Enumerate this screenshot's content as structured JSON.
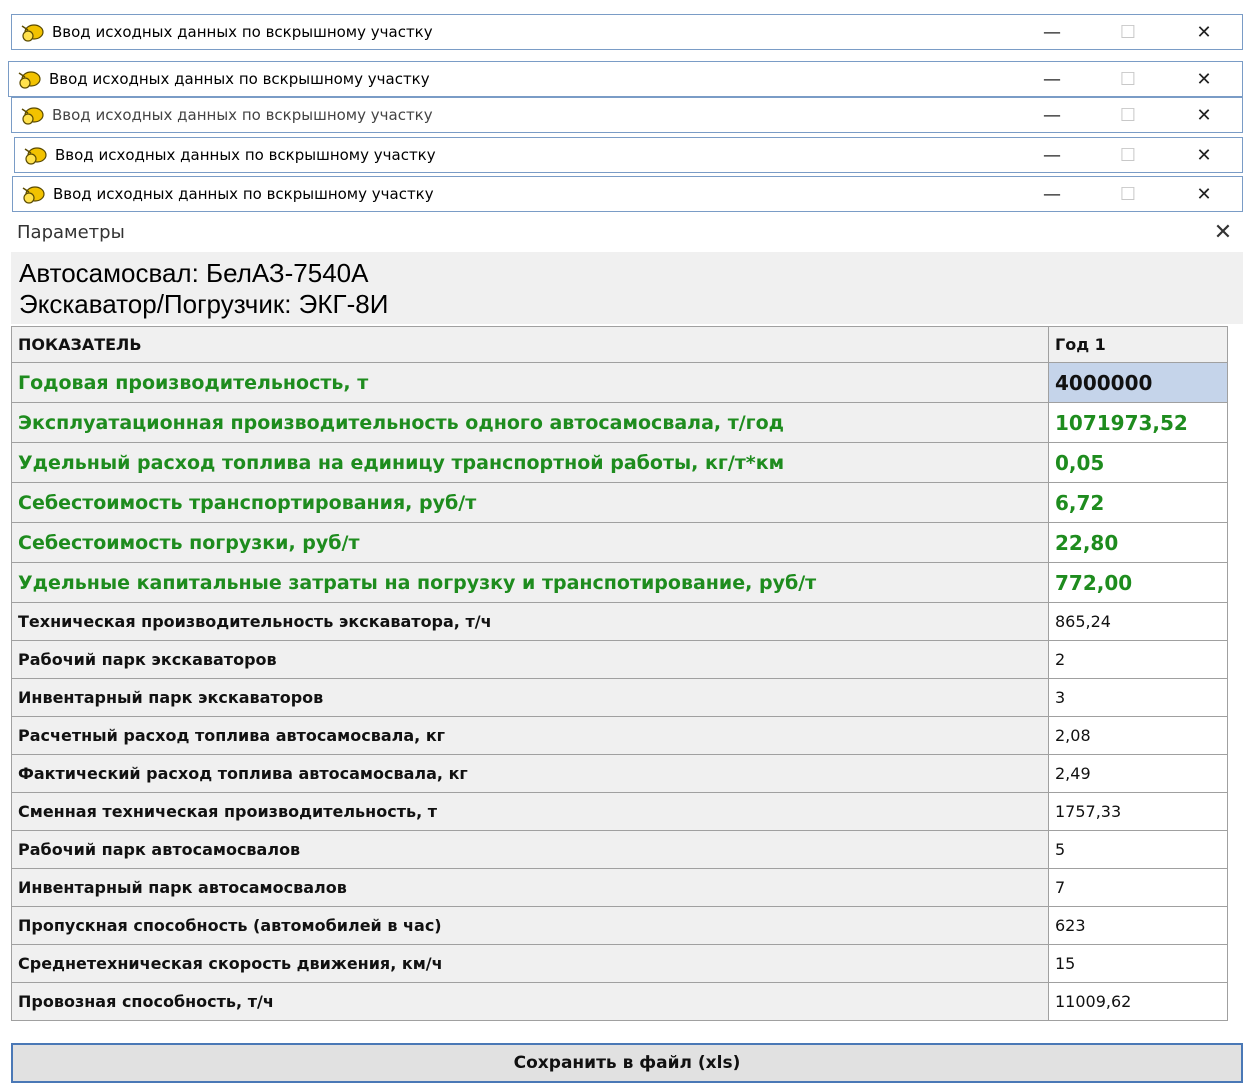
{
  "window_title": "Ввод исходных данных по вскрышному участку",
  "title_controls": {
    "minimize": "—",
    "maximize": "☐",
    "close": "✕"
  },
  "params_panel": {
    "title": "Параметры",
    "close": "✕"
  },
  "info": {
    "truck_line": "Автосамосвал: БелАЗ-7540А",
    "excavator_line": "Экскаватор/Погрузчик: ЭКГ-8И"
  },
  "table": {
    "headers": [
      "ПОКАЗАТЕЛЬ",
      "Год 1"
    ],
    "rows": [
      {
        "label": "Годовая производительность, т",
        "value": "4000000",
        "highlight": true
      },
      {
        "label": "Эксплуатационная производительность одного автосамосвала, т/год",
        "value": "1071973,52",
        "highlight": true
      },
      {
        "label": "Удельный расход топлива на единицу транспортной работы, кг/т*км",
        "value": "0,05",
        "highlight": true
      },
      {
        "label": "Себестоимость транспортирования, руб/т",
        "value": "6,72",
        "highlight": true
      },
      {
        "label": "Себестоимость погрузки, руб/т",
        "value": "22,80",
        "highlight": true
      },
      {
        "label": "Удельные капитальные затраты на погрузку и транспотирование, руб/т",
        "value": "772,00",
        "highlight": true
      },
      {
        "label": "Техническая производительность экскаватора, т/ч",
        "value": "865,24",
        "highlight": false
      },
      {
        "label": "Рабочий парк экскаваторов",
        "value": "2",
        "highlight": false
      },
      {
        "label": "Инвентарный парк экскаваторов",
        "value": "3",
        "highlight": false
      },
      {
        "label": "Расчетный расход топлива автосамосвала, кг",
        "value": "2,08",
        "highlight": false
      },
      {
        "label": "Фактический расход топлива автосамосвала, кг",
        "value": "2,49",
        "highlight": false
      },
      {
        "label": "Сменная техническая производительность, т",
        "value": "1757,33",
        "highlight": false
      },
      {
        "label": "Рабочий парк автосамосвалов",
        "value": "5",
        "highlight": false
      },
      {
        "label": "Инвентарный парк автосамосвалов",
        "value": "7",
        "highlight": false
      },
      {
        "label": "Пропускная способность (автомобилей в час)",
        "value": "623",
        "highlight": false
      },
      {
        "label": "Среднетехническая скорость движения, км/ч",
        "value": "15",
        "highlight": false
      },
      {
        "label": "Провозная способность, т/ч",
        "value": "11009,62",
        "highlight": false
      }
    ]
  },
  "save_button": "Сохранить в файл (xls)",
  "colors": {
    "highlight_text": "#1e8c1e",
    "selected_cell": "#c5d4ea",
    "window_border": "#7a9cc6"
  }
}
